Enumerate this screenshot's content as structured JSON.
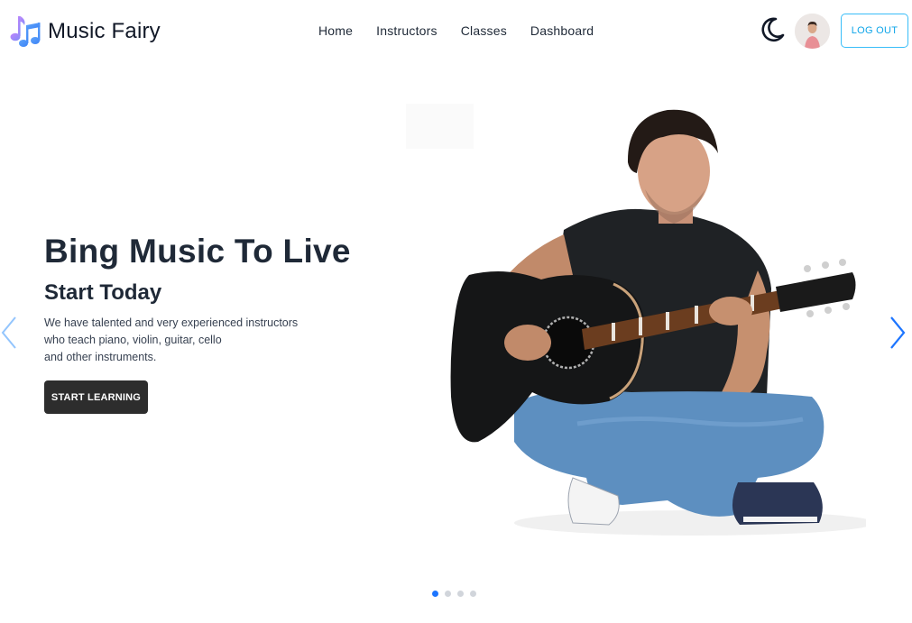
{
  "brand": {
    "name": "Music Fairy",
    "icon": "music-notes-icon"
  },
  "nav": {
    "links": [
      "Home",
      "Instructors",
      "Classes",
      "Dashboard"
    ]
  },
  "header_actions": {
    "theme_icon": "moon-icon",
    "logout_label": "LOG OUT"
  },
  "hero": {
    "title": "Bing Music To Live",
    "subtitle": "Start Today",
    "description_lines": [
      "We have talented and very experienced instructors",
      "who teach piano, violin, guitar, cello",
      "and other instruments."
    ],
    "cta_label": "START LEARNING"
  },
  "carousel": {
    "slide_count": 4,
    "active_index": 0
  },
  "colors": {
    "accent": "#0ea5e9",
    "dark_button": "#2d2d2d",
    "active_dot": "#1d75ff",
    "arrow": "#1d75ff"
  }
}
